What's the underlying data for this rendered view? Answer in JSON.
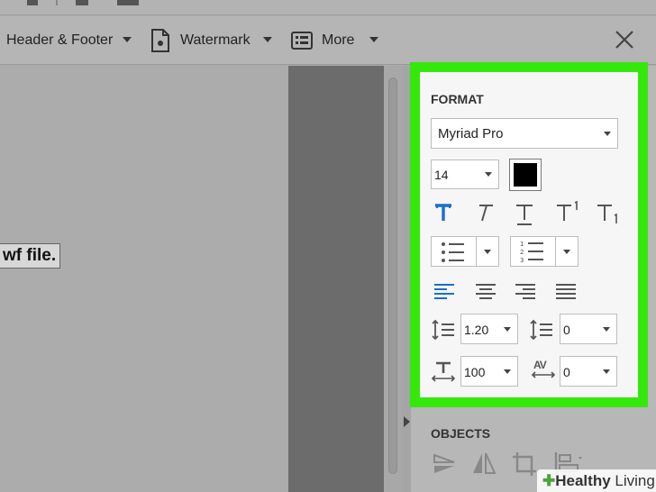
{
  "toolbar": {
    "header_footer_label": "Header & Footer",
    "watermark_label": "Watermark",
    "more_label": "More"
  },
  "document": {
    "visible_text": "wf file."
  },
  "format_panel": {
    "title": "FORMAT",
    "font_family": "Myriad Pro",
    "font_size": "14",
    "text_color": "#000000",
    "line_spacing": "1.20",
    "paragraph_spacing": "0",
    "horizontal_scale": "100",
    "character_spacing": "0",
    "char_spacing_label": "AV"
  },
  "objects_panel": {
    "title": "OBJECTS"
  },
  "watermark_badge": {
    "healthy": "Healthy",
    "living": "Living"
  },
  "colors": {
    "highlight": "#35e80c",
    "accent_blue": "#1a6fcf"
  }
}
